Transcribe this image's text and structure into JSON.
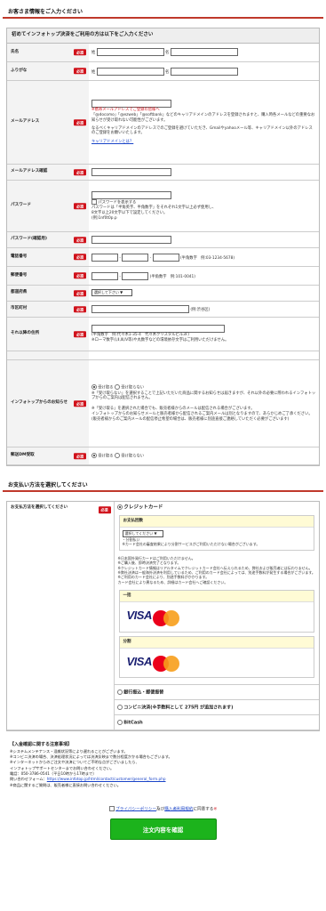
{
  "customer": {
    "title": "お客さま情報をご入力ください",
    "subhead": "初めてインフォトップ決済をご利用の方は以下をご入力ください",
    "required": "必須",
    "fields": {
      "name": "氏名",
      "furigana": "ふりがな",
      "email": "メールアドレス",
      "email_confirm": "メールアドレス確認",
      "password": "パスワード",
      "password_confirm": "パスワード(確認用)",
      "tel": "電話番号",
      "zip": "郵便番号",
      "pref": "都道府県",
      "city": "市区町村",
      "address": "それ以降の住所",
      "newsletter": "インフォトップからのお知らせ",
      "mail_dm": "郵送DM受取"
    },
    "sei": "姓",
    "mei": "名",
    "email_warn": "※携帯メールアドレスでご登録の皆様へ",
    "email_note1": "「@docomo」「@ezweb」「@softbank」などのキャリアドメインのアドレスを登録されますと、購入時各メールなどの重要なお知らせが受け取れない可能性がございます。",
    "email_note2": "なるべくキャリアドメインのアドレスでのご登録を避けていただき、Gmailやyahooメール等、キャリアドメイン以外のアドレスのご登録をお願いいたします。",
    "email_link": "キャリアドメインとは？",
    "pw_show": "パスワードを表示する",
    "pw_note1": "パスワードは「半角英字、半角数字」をそれぞれ1文字以上必ず使用し、",
    "pw_note2": "8文字以上20文字以下で設定してください。",
    "pw_note3": "(例)1nf0t0p.p",
    "dash": "-",
    "tel_hint": "(半角数字　例:03-1234-5678)",
    "zip_hint": "(半角数字　例:101-0041)",
    "pref_select": "選択して下さい",
    "city_hint": "(例:渋谷区)",
    "addr_hint1": "(半角数字　例:代々木1-35-4　代々木クリスタルビル3F)",
    "addr_hint2": "※ローマ数字(Ⅰ,Ⅱ,Ⅲ,Ⅳ等)や丸数字などの環境依存文字はご利用いただけません。",
    "recv": "受け取る",
    "norecv": "受け取らない",
    "news_note1": "※「受け取らない」を選択することで上記いただいた商品に関するお知らせは届きますが、それ以外の必要に際われるインフォトップからのご案内は配信されません。",
    "news_note2": "※「受け取る」を選択された場合でも、販売者様からのメールは配信される場合がございます。",
    "news_note3": "インフォトップからのお知らせメールと販売者様から配信されるご案内メールは別となりますので、あらかじめご了承ください。",
    "news_note4": "(販売者様からのご案内メールの配信停止希望の場合は、販売者様に別途直接ご連絡していただく必要がございます)"
  },
  "payment": {
    "title": "お支払い方法を選択してください",
    "label": "お支払方法を選択してください",
    "required": "必須",
    "credit": "クレジットカード",
    "count_label": "お支払回数",
    "count_select": "選択してください",
    "count_note1": "・分割払い",
    "count_note2": "※カード会社の審査結果により分割サービスがご利用いただけない場合がございます。",
    "notes": [
      "※日本国外発行カードはご利用いただけません。",
      "※ご購入後、即時決済完了となります。",
      "※クレジットカード情報はリアルタイムでクレジットカード会社へ伝えられるため、弊社および販売者には伝わりません。",
      "※弊社決済は一般海外決済を利用しているため、ご利用のカード会社によっては、別途手数料が発生する場合がございます。",
      "※ご利用のカード会社により、別途手数料がかかります。",
      "カード会社により異なるため、詳細はカード会社へご確認ください。"
    ],
    "lump": "一括",
    "split": "分割",
    "visa": "VISA",
    "bank": "銀行振込・郵便振替",
    "conv": "コンビニ決済(※手数料として 275円 が追加されます)",
    "bitcash": "BitCash"
  },
  "notice": {
    "title": "【入金確認に関する注意事項】",
    "lines": [
      "※システムメンテナンス・混雑状況等により遅れることがございます。",
      "※コンビニ決済の場合、決済処理状況によっては決済反映まで数分程度かかる場合もございます。",
      "※インターネットからのご注文や決済についてご不明な点がございましたら、",
      "インフォトップサポートセンターまでお問い合わせください。",
      "電話：050-3786-0541（平日10時から17時まで）",
      "※商品に関するご質問は、販売者様に直接お問い合わせください。"
    ],
    "form_prefix": "問い合わせフォーム：",
    "form_link": "https://www.infotop.jp/html/contact/customer/general_form.php"
  },
  "privacy": {
    "link1": "プライバシーポリシー",
    "mid": "及び",
    "link2": "購入者利用規約",
    "suffix": "に同意する",
    "mark": "※"
  },
  "submit": "注文内容を確認"
}
